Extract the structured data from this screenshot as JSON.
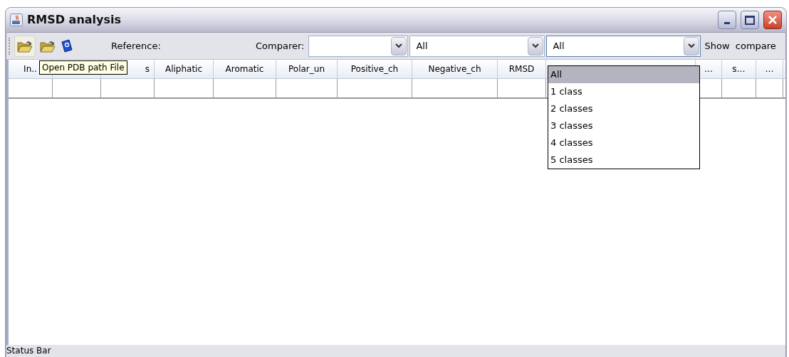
{
  "window": {
    "title": "RMSD analysis"
  },
  "toolbar": {
    "reference_label": "Reference:",
    "comparer_label": "Comparer:",
    "combos": [
      {
        "open": false
      },
      {
        "value": "All",
        "open": false
      },
      {
        "value": "All",
        "open": true
      }
    ],
    "show_compare": "Show  compare"
  },
  "tooltip": "Open PDB path File",
  "table": {
    "columns": [
      {
        "label": "In.."
      },
      {},
      {
        "label": "s"
      },
      {
        "label": "Aliphatic"
      },
      {
        "label": "Aromatic"
      },
      {
        "label": "Polar_un"
      },
      {
        "label": "Positive_ch"
      },
      {
        "label": "Negative_ch"
      },
      {
        "label": "RMSD"
      },
      {},
      {
        "label": "…"
      },
      {
        "label": "s…"
      },
      {
        "label": "…"
      }
    ]
  },
  "dropdown": {
    "items": [
      {
        "label": "All",
        "selected": true
      },
      {
        "label": "1 class",
        "selected": false
      },
      {
        "label": "2 classes",
        "selected": false
      },
      {
        "label": "3 classes",
        "selected": false
      },
      {
        "label": "4 classes",
        "selected": false
      },
      {
        "label": "5 classes",
        "selected": false
      }
    ]
  },
  "status_bar": "Status Bar"
}
